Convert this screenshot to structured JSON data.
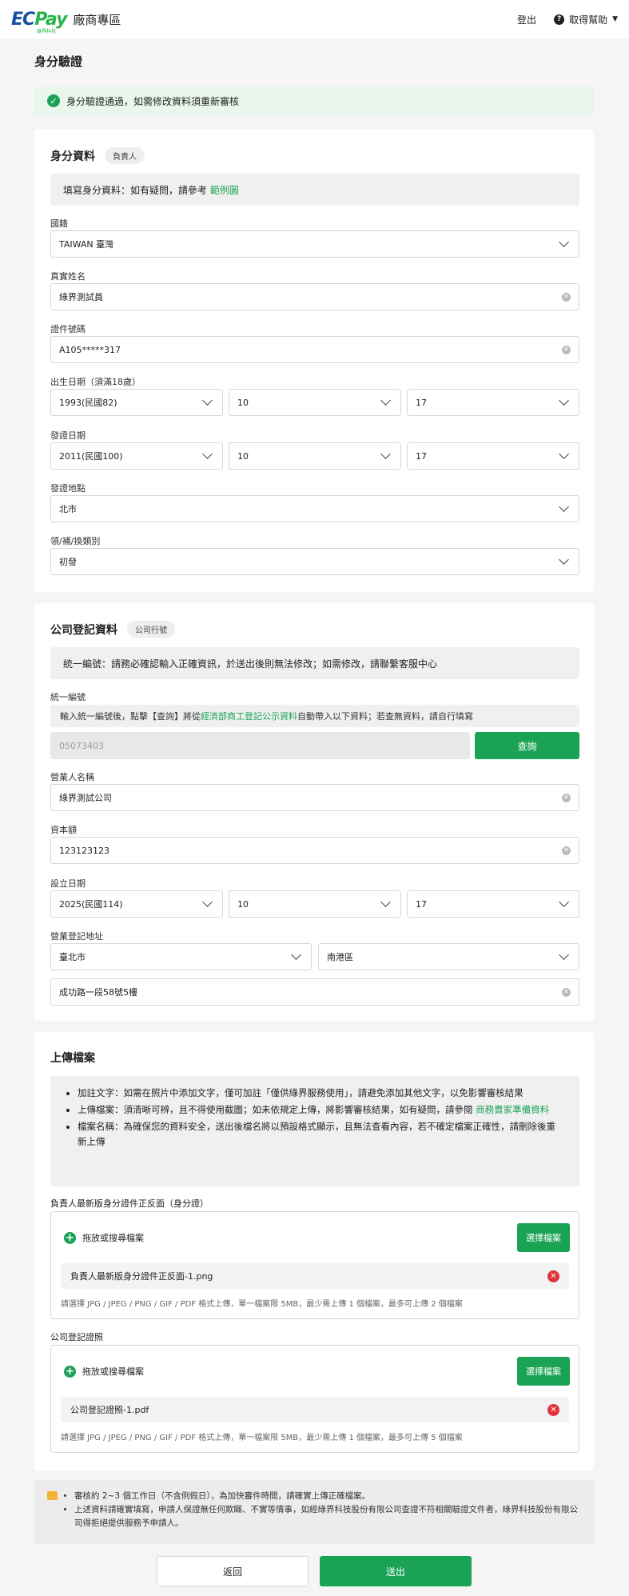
{
  "header": {
    "logo_ec": "EC",
    "logo_pay": "Pay",
    "logo_sub": "綠界科技",
    "logo_text": "廠商專區",
    "logout": "登出",
    "help": "取得幫助"
  },
  "page_title": "身分驗證",
  "alert": "身分驗證通過，如需修改資料須重新審核",
  "identity": {
    "title": "身分資料",
    "tag": "負責人",
    "info_prefix": "填寫身分資料：如有疑問，請參考",
    "info_link": "範例圖",
    "nationality_label": "國籍",
    "nationality_value": "TAIWAN 臺灣",
    "name_label": "真實姓名",
    "name_value": "綠界測試員",
    "id_label": "證件號碼",
    "id_value": "A105*****317",
    "birth_label": "出生日期（須滿18歲）",
    "birth_year": "1993(民國82)",
    "birth_month": "10",
    "birth_day": "17",
    "issue_label": "發證日期",
    "issue_year": "2011(民國100)",
    "issue_month": "10",
    "issue_day": "17",
    "place_label": "發證地點",
    "place_value": "北市",
    "type_label": "領/補/換類別",
    "type_value": "初發"
  },
  "company": {
    "title": "公司登記資料",
    "tag": "公司行號",
    "info": "統一編號：請務必確認輸入正確資訊，於送出後則無法修改；如需修改，請聯繫客服中心",
    "taxid_label": "統一編號",
    "taxid_hint_prefix": "輸入統一編號後，點擊【查詢】將從",
    "taxid_hint_link": "經濟部商工登記公示資料",
    "taxid_hint_suffix": "自動帶入以下資料；若查無資料，請自行填寫",
    "taxid_value": "05073403",
    "query_button": "查詢",
    "biz_name_label": "營業人名稱",
    "biz_name_value": "綠界測試公司",
    "capital_label": "資本額",
    "capital_value": "123123123",
    "founded_label": "設立日期",
    "founded_year": "2025(民國114)",
    "founded_month": "10",
    "founded_day": "17",
    "address_label": "營業登記地址",
    "city_value": "臺北市",
    "district_value": "南港區",
    "street_value": "成功路一段58號5樓"
  },
  "upload": {
    "title": "上傳檔案",
    "notes": [
      {
        "text": "加註文字：如需在照片中添加文字，僅可加註「僅供綠界服務使用」，請避免添加其他文字，以免影響審核結果",
        "link": ""
      },
      {
        "text": "上傳檔案：須清晰可辨，且不得使用截圖；如未依規定上傳，將影響審核結果，如有疑問，請參閱",
        "link": "商務賣家準備資料"
      },
      {
        "text": "檔案名稱：為確保您的資料安全，送出後檔名將以預設格式顯示，且無法查看內容，若不確定檔案正確性，請刪除後重新上傳",
        "link": ""
      }
    ],
    "id_doc_label": "負責人最新版身分證件正反面（身分證）",
    "drop_text": "拖放或搜尋檔案",
    "choose_button": "選擇檔案",
    "id_doc_file": "負責人最新版身分證件正反面-1.png",
    "id_doc_hint": "請選擇 JPG / JPEG / PNG / GIF / PDF 格式上傳，單一檔案限 5MB，最少需上傳 1 個檔案，最多可上傳 2 個檔案",
    "reg_doc_label": "公司登記證照",
    "reg_doc_file": "公司登記證照-1.pdf",
    "reg_doc_hint": "請選擇 JPG / JPEG / PNG / GIF / PDF 格式上傳，單一檔案限 5MB，最少需上傳 1 個檔案，最多可上傳 5 個檔案"
  },
  "footer_notes": [
    "審核約 2~3 個工作日（不含例假日），為加快審件時間，請確實上傳正確檔案。",
    "上述資料請確實填寫，申請人保證無任何欺瞞、不實等情事，如經綠界科技股份有限公司查證不符相關驗證文件者，綠界科技股份有限公司得拒絕提供服務予申請人。"
  ],
  "buttons": {
    "back": "返回",
    "submit": "送出"
  },
  "colors": {
    "accent": "#1ba355",
    "danger": "#e0323a",
    "brand_blue": "#1a4fa0"
  }
}
